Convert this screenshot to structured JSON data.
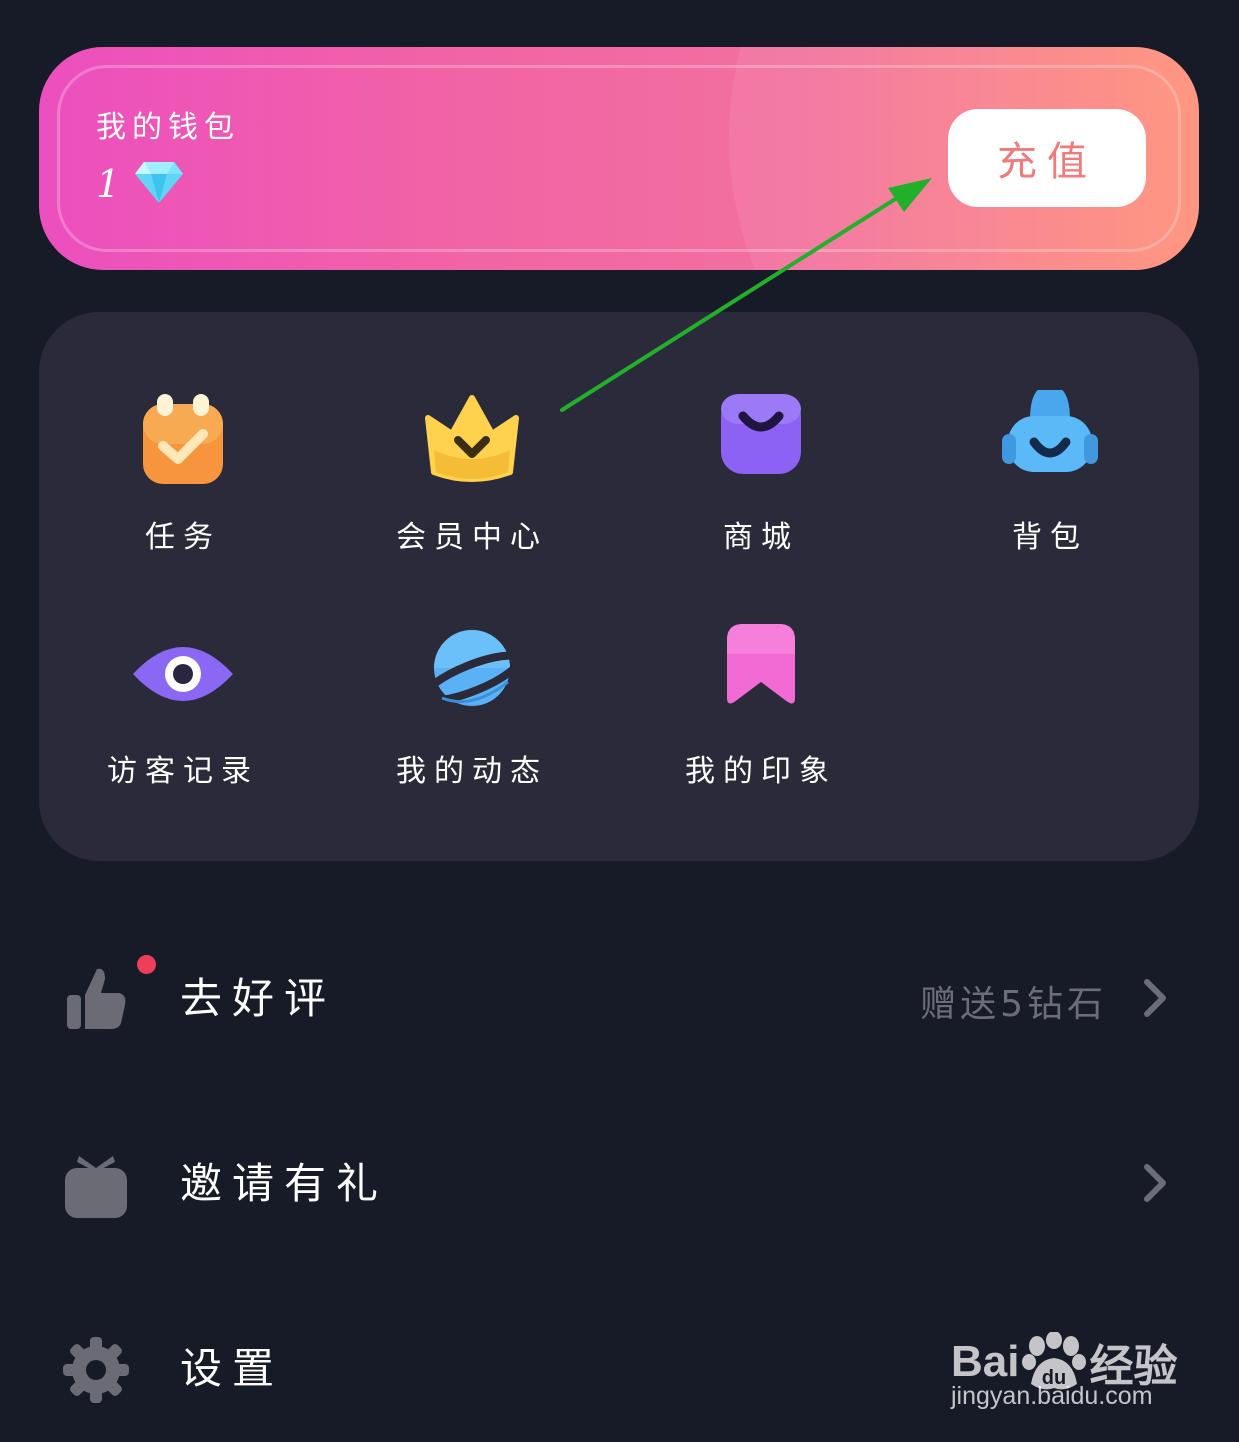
{
  "wallet": {
    "title": "我的钱包",
    "amount": "1",
    "currency_icon": "diamond-icon",
    "recharge_label": "充值"
  },
  "grid": {
    "items": [
      {
        "label": "任务",
        "icon": "task-icon"
      },
      {
        "label": "会员中心",
        "icon": "crown-icon"
      },
      {
        "label": "商城",
        "icon": "shopping-bag-icon"
      },
      {
        "label": "背包",
        "icon": "backpack-icon"
      },
      {
        "label": "访客记录",
        "icon": "eye-icon"
      },
      {
        "label": "我的动态",
        "icon": "planet-icon"
      },
      {
        "label": "我的印象",
        "icon": "bookmark-icon"
      }
    ]
  },
  "list": {
    "review": {
      "label": "去好评",
      "hint": "赠送5钻石",
      "icon": "thumbs-up-icon",
      "has_badge": true
    },
    "invite": {
      "label": "邀请有礼",
      "icon": "gift-icon"
    },
    "settings": {
      "label": "设置",
      "icon": "gear-icon"
    }
  },
  "watermark": {
    "brand_left": "Bai",
    "brand_mid": "du",
    "brand_right": "经验",
    "url": "jingyan.baidu.com"
  },
  "colors": {
    "background": "#171a27",
    "card": "#2a2a3a",
    "wallet_gradient_start": "#ec4fbf",
    "wallet_gradient_end": "#ff8f78",
    "recharge_text": "#f07a7c",
    "arrow": "#22b02b",
    "badge": "#ef3f57"
  }
}
